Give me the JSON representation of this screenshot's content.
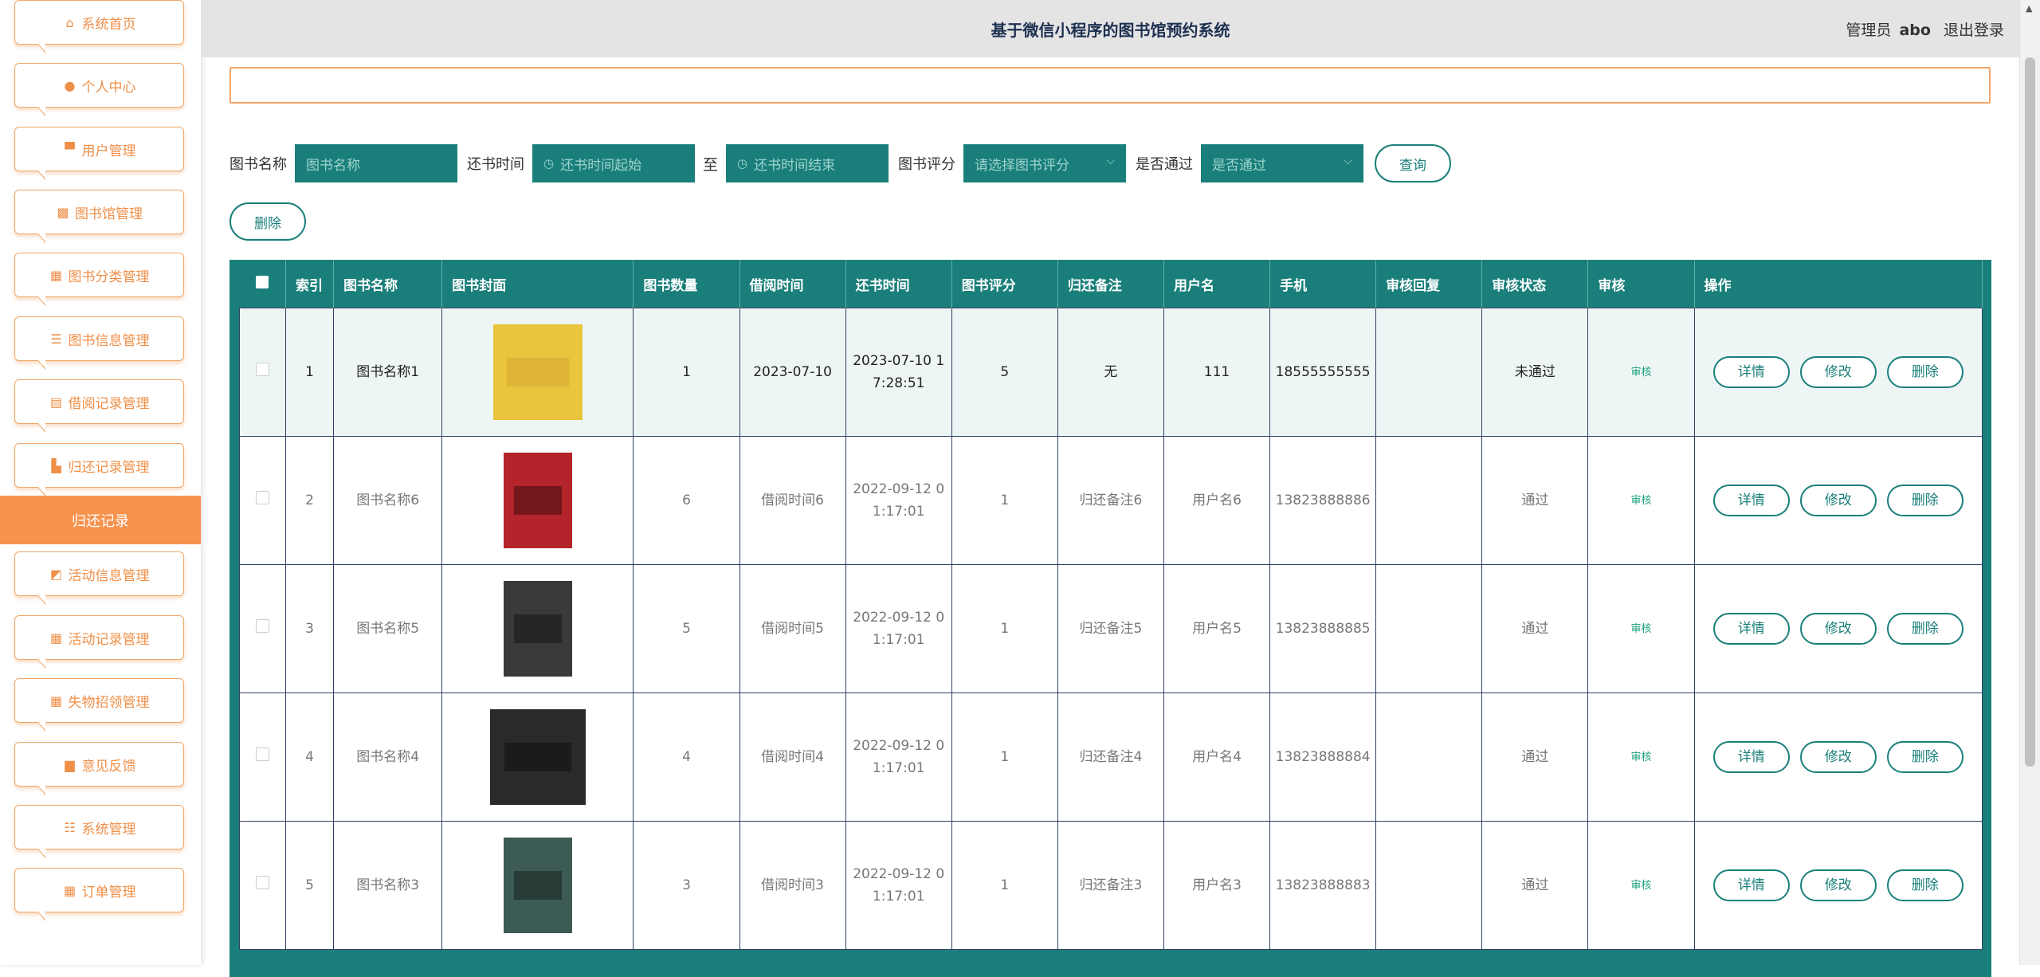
{
  "header": {
    "title": "基于微信小程序的图书馆预约系统",
    "role": "管理员",
    "username": "abo",
    "logout": "退出登录"
  },
  "sidebar": {
    "items": [
      {
        "label": "系统首页",
        "icon": "home-icon",
        "glyph": "⌂"
      },
      {
        "label": "个人中心",
        "icon": "user-icon",
        "glyph": "●"
      },
      {
        "label": "用户管理",
        "icon": "monitor-icon",
        "glyph": "▀"
      },
      {
        "label": "图书馆管理",
        "icon": "ticket-icon",
        "glyph": "▩"
      },
      {
        "label": "图书分类管理",
        "icon": "grid-icon",
        "glyph": "▦"
      },
      {
        "label": "图书信息管理",
        "icon": "list-icon",
        "glyph": "☰"
      },
      {
        "label": "借阅记录管理",
        "icon": "clipboard-icon",
        "glyph": "▤"
      },
      {
        "label": "归还记录管理",
        "icon": "thumb-icon",
        "glyph": "▙"
      },
      {
        "label": "活动信息管理",
        "icon": "chart-icon",
        "glyph": "◩"
      },
      {
        "label": "活动记录管理",
        "icon": "grid-icon",
        "glyph": "▦"
      },
      {
        "label": "失物招领管理",
        "icon": "grid-icon",
        "glyph": "▦"
      },
      {
        "label": "意见反馈",
        "icon": "chat-icon",
        "glyph": "▆"
      },
      {
        "label": "系统管理",
        "icon": "sliders-icon",
        "glyph": "☷"
      },
      {
        "label": "订单管理",
        "icon": "grid-icon",
        "glyph": "▦"
      }
    ],
    "active_sub": "归还记录"
  },
  "search": {
    "book_name_label": "图书名称",
    "book_name_placeholder": "图书名称",
    "return_time_label": "还书时间",
    "start_placeholder": "还书时间起始",
    "to": "至",
    "end_placeholder": "还书时间结束",
    "rating_label": "图书评分",
    "rating_placeholder": "请选择图书评分",
    "pass_label": "是否通过",
    "pass_placeholder": "是否通过",
    "query_button": "查询"
  },
  "actions": {
    "delete_button": "删除"
  },
  "table": {
    "headers": [
      "索引",
      "图书名称",
      "图书封面",
      "图书数量",
      "借阅时间",
      "还书时间",
      "图书评分",
      "归还备注",
      "用户名",
      "手机",
      "审核回复",
      "审核状态",
      "审核",
      "操作"
    ],
    "row_actions": {
      "detail": "详情",
      "edit": "修改",
      "delete": "删除"
    },
    "rows": [
      {
        "index": "1",
        "name": "图书名称1",
        "qty": "1",
        "borrow": "2023-07-10",
        "ret": "2023-07-10 17:28:51",
        "rating": "5",
        "note": "无",
        "user": "111",
        "phone": "18555555555",
        "reply": "",
        "status": "未通过",
        "audit": "审核",
        "cover_color": "#e9c43c"
      },
      {
        "index": "2",
        "name": "图书名称6",
        "qty": "6",
        "borrow": "借阅时间6",
        "ret": "2022-09-12 01:17:01",
        "rating": "1",
        "note": "归还备注6",
        "user": "用户名6",
        "phone": "13823888886",
        "reply": "",
        "status": "通过",
        "audit": "审核",
        "cover_color": "#b3242b"
      },
      {
        "index": "3",
        "name": "图书名称5",
        "qty": "5",
        "borrow": "借阅时间5",
        "ret": "2022-09-12 01:17:01",
        "rating": "1",
        "note": "归还备注5",
        "user": "用户名5",
        "phone": "13823888885",
        "reply": "",
        "status": "通过",
        "audit": "审核",
        "cover_color": "#3a3a3a"
      },
      {
        "index": "4",
        "name": "图书名称4",
        "qty": "4",
        "borrow": "借阅时间4",
        "ret": "2022-09-12 01:17:01",
        "rating": "1",
        "note": "归还备注4",
        "user": "用户名4",
        "phone": "13823888884",
        "reply": "",
        "status": "通过",
        "audit": "审核",
        "cover_color": "#2a2a2a"
      },
      {
        "index": "5",
        "name": "图书名称3",
        "qty": "3",
        "borrow": "借阅时间3",
        "ret": "2022-09-12 01:17:01",
        "rating": "1",
        "note": "归还备注3",
        "user": "用户名3",
        "phone": "13823888883",
        "reply": "",
        "status": "通过",
        "audit": "审核",
        "cover_color": "#3d5b55"
      }
    ]
  },
  "colors": {
    "accent_orange": "#f7924d",
    "teal": "#1a7f7a"
  }
}
